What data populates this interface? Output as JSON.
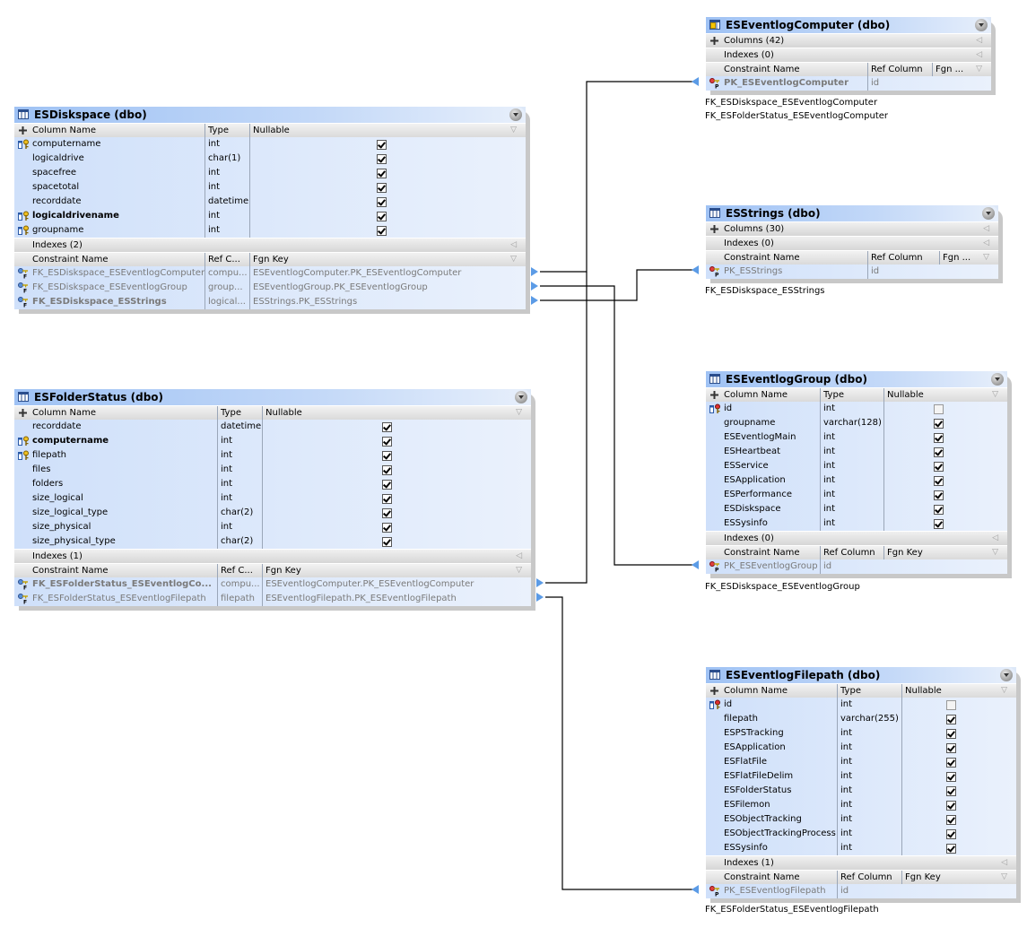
{
  "tables": {
    "esdiskspace": {
      "title": "ESDiskspace (dbo)",
      "headers": {
        "column_name": "Column Name",
        "type": "Type",
        "nullable": "Nullable"
      },
      "columns": [
        {
          "name": "computername",
          "type": "int",
          "nullable": true,
          "key": "fk",
          "bold": false
        },
        {
          "name": "logicaldrive",
          "type": "char(1)",
          "nullable": true,
          "key": "",
          "bold": false
        },
        {
          "name": "spacefree",
          "type": "int",
          "nullable": true,
          "key": "",
          "bold": false
        },
        {
          "name": "spacetotal",
          "type": "int",
          "nullable": true,
          "key": "",
          "bold": false
        },
        {
          "name": "recorddate",
          "type": "datetime",
          "nullable": true,
          "key": "",
          "bold": false
        },
        {
          "name": "logicaldrivename",
          "type": "int",
          "nullable": true,
          "key": "fk",
          "bold": true
        },
        {
          "name": "groupname",
          "type": "int",
          "nullable": true,
          "key": "fk",
          "bold": false
        }
      ],
      "indexes": "Indexes (2)",
      "constraint_headers": {
        "name": "Constraint Name",
        "ref": "Ref C...",
        "fgn": "Fgn Key"
      },
      "constraints": [
        {
          "name": "FK_ESDiskspace_ESEventlogComputer",
          "ref": "compu...",
          "fgn": "ESEventlogComputer.PK_ESEventlogComputer",
          "bold": false
        },
        {
          "name": "FK_ESDiskspace_ESEventlogGroup",
          "ref": "group...",
          "fgn": "ESEventlogGroup.PK_ESEventlogGroup",
          "bold": false
        },
        {
          "name": "FK_ESDiskspace_ESStrings",
          "ref": "logical...",
          "fgn": "ESStrings.PK_ESStrings",
          "bold": true
        }
      ]
    },
    "esfolderstatus": {
      "title": "ESFolderStatus (dbo)",
      "headers": {
        "column_name": "Column Name",
        "type": "Type",
        "nullable": "Nullable"
      },
      "columns": [
        {
          "name": "recorddate",
          "type": "datetime",
          "nullable": true,
          "key": "",
          "bold": false
        },
        {
          "name": "computername",
          "type": "int",
          "nullable": true,
          "key": "fk",
          "bold": true
        },
        {
          "name": "filepath",
          "type": "int",
          "nullable": true,
          "key": "fk",
          "bold": false
        },
        {
          "name": "files",
          "type": "int",
          "nullable": true,
          "key": "",
          "bold": false
        },
        {
          "name": "folders",
          "type": "int",
          "nullable": true,
          "key": "",
          "bold": false
        },
        {
          "name": "size_logical",
          "type": "int",
          "nullable": true,
          "key": "",
          "bold": false
        },
        {
          "name": "size_logical_type",
          "type": "char(2)",
          "nullable": true,
          "key": "",
          "bold": false
        },
        {
          "name": "size_physical",
          "type": "int",
          "nullable": true,
          "key": "",
          "bold": false
        },
        {
          "name": "size_physical_type",
          "type": "char(2)",
          "nullable": true,
          "key": "",
          "bold": false
        }
      ],
      "indexes": "Indexes (1)",
      "constraint_headers": {
        "name": "Constraint Name",
        "ref": "Ref C...",
        "fgn": "Fgn Key"
      },
      "constraints": [
        {
          "name": "FK_ESFolderStatus_ESEventlogCo...",
          "ref": "compu...",
          "fgn": "ESEventlogComputer.PK_ESEventlogComputer",
          "bold": true
        },
        {
          "name": "FK_ESFolderStatus_ESEventlogFilepath",
          "ref": "filepath",
          "fgn": "ESEventlogFilepath.PK_ESEventlogFilepath",
          "bold": false
        }
      ]
    },
    "eseventlogcomputer": {
      "title": "ESEventlogComputer (dbo)",
      "columns_collapsed": "Columns (42)",
      "indexes": "Indexes (0)",
      "constraint_headers": {
        "name": "Constraint Name",
        "ref": "Ref Column",
        "fgn": "Fgn ..."
      },
      "constraints": [
        {
          "name": "PK_ESEventlogComputer",
          "ref": "id",
          "fgn": "",
          "bold": true
        }
      ],
      "fk_references": [
        "FK_ESDiskspace_ESEventlogComputer",
        "FK_ESFolderStatus_ESEventlogComputer"
      ]
    },
    "esstrings": {
      "title": "ESStrings (dbo)",
      "columns_collapsed": "Columns (30)",
      "indexes": "Indexes (0)",
      "constraint_headers": {
        "name": "Constraint Name",
        "ref": "Ref Column",
        "fgn": "Fgn ..."
      },
      "constraints": [
        {
          "name": "PK_ESStrings",
          "ref": "id",
          "fgn": "",
          "bold": false
        }
      ],
      "fk_references": [
        "FK_ESDiskspace_ESStrings"
      ]
    },
    "eseventloggroup": {
      "title": "ESEventlogGroup (dbo)",
      "headers": {
        "column_name": "Column Name",
        "type": "Type",
        "nullable": "Nullable"
      },
      "columns": [
        {
          "name": "id",
          "type": "int",
          "nullable": false,
          "key": "pk",
          "bold": false
        },
        {
          "name": "groupname",
          "type": "varchar(128)",
          "nullable": true,
          "key": "",
          "bold": false
        },
        {
          "name": "ESEventlogMain",
          "type": "int",
          "nullable": true,
          "key": "",
          "bold": false
        },
        {
          "name": "ESHeartbeat",
          "type": "int",
          "nullable": true,
          "key": "",
          "bold": false
        },
        {
          "name": "ESService",
          "type": "int",
          "nullable": true,
          "key": "",
          "bold": false
        },
        {
          "name": "ESApplication",
          "type": "int",
          "nullable": true,
          "key": "",
          "bold": false
        },
        {
          "name": "ESPerformance",
          "type": "int",
          "nullable": true,
          "key": "",
          "bold": false
        },
        {
          "name": "ESDiskspace",
          "type": "int",
          "nullable": true,
          "key": "",
          "bold": false
        },
        {
          "name": "ESSysinfo",
          "type": "int",
          "nullable": true,
          "key": "",
          "bold": false
        }
      ],
      "indexes": "Indexes (0)",
      "constraint_headers": {
        "name": "Constraint Name",
        "ref": "Ref Column",
        "fgn": "Fgn Key"
      },
      "constraints": [
        {
          "name": "PK_ESEventlogGroup",
          "ref": "id",
          "fgn": "",
          "bold": false
        }
      ],
      "fk_references": [
        "FK_ESDiskspace_ESEventlogGroup"
      ]
    },
    "eseventlogfilepath": {
      "title": "ESEventlogFilepath (dbo)",
      "headers": {
        "column_name": "Column Name",
        "type": "Type",
        "nullable": "Nullable"
      },
      "columns": [
        {
          "name": "id",
          "type": "int",
          "nullable": false,
          "key": "pk",
          "bold": false
        },
        {
          "name": "filepath",
          "type": "varchar(255)",
          "nullable": true,
          "key": "",
          "bold": false
        },
        {
          "name": "ESPSTracking",
          "type": "int",
          "nullable": true,
          "key": "",
          "bold": false
        },
        {
          "name": "ESApplication",
          "type": "int",
          "nullable": true,
          "key": "",
          "bold": false
        },
        {
          "name": "ESFlatFile",
          "type": "int",
          "nullable": true,
          "key": "",
          "bold": false
        },
        {
          "name": "ESFlatFileDelim",
          "type": "int",
          "nullable": true,
          "key": "",
          "bold": false
        },
        {
          "name": "ESFolderStatus",
          "type": "int",
          "nullable": true,
          "key": "",
          "bold": false
        },
        {
          "name": "ESFilemon",
          "type": "int",
          "nullable": true,
          "key": "",
          "bold": false
        },
        {
          "name": "ESObjectTracking",
          "type": "int",
          "nullable": true,
          "key": "",
          "bold": false
        },
        {
          "name": "ESObjectTrackingProcess",
          "type": "int",
          "nullable": true,
          "key": "",
          "bold": false
        },
        {
          "name": "ESSysinfo",
          "type": "int",
          "nullable": true,
          "key": "",
          "bold": false
        }
      ],
      "indexes": "Indexes (1)",
      "constraint_headers": {
        "name": "Constraint Name",
        "ref": "Ref Column",
        "fgn": "Fgn Key"
      },
      "constraints": [
        {
          "name": "PK_ESEventlogFilepath",
          "ref": "id",
          "fgn": "",
          "bold": false
        }
      ],
      "fk_references": [
        "FK_ESFolderStatus_ESEventlogFilepath"
      ]
    }
  },
  "relationships": [
    {
      "from": "FK_ESDiskspace_ESEventlogComputer",
      "to": "PK_ESEventlogComputer"
    },
    {
      "from": "FK_ESDiskspace_ESEventlogGroup",
      "to": "PK_ESEventlogGroup"
    },
    {
      "from": "FK_ESDiskspace_ESStrings",
      "to": "PK_ESStrings"
    },
    {
      "from": "FK_ESFolderStatus_ESEventlogComputer",
      "to": "PK_ESEventlogComputer"
    },
    {
      "from": "FK_ESFolderStatus_ESEventlogFilepath",
      "to": "PK_ESEventlogFilepath"
    }
  ],
  "colors": {
    "title_gradient_start": "#9fc2f4",
    "row_blue": "#cfe0fa",
    "arrow_blue": "#5b9be6",
    "line": "#000000"
  }
}
